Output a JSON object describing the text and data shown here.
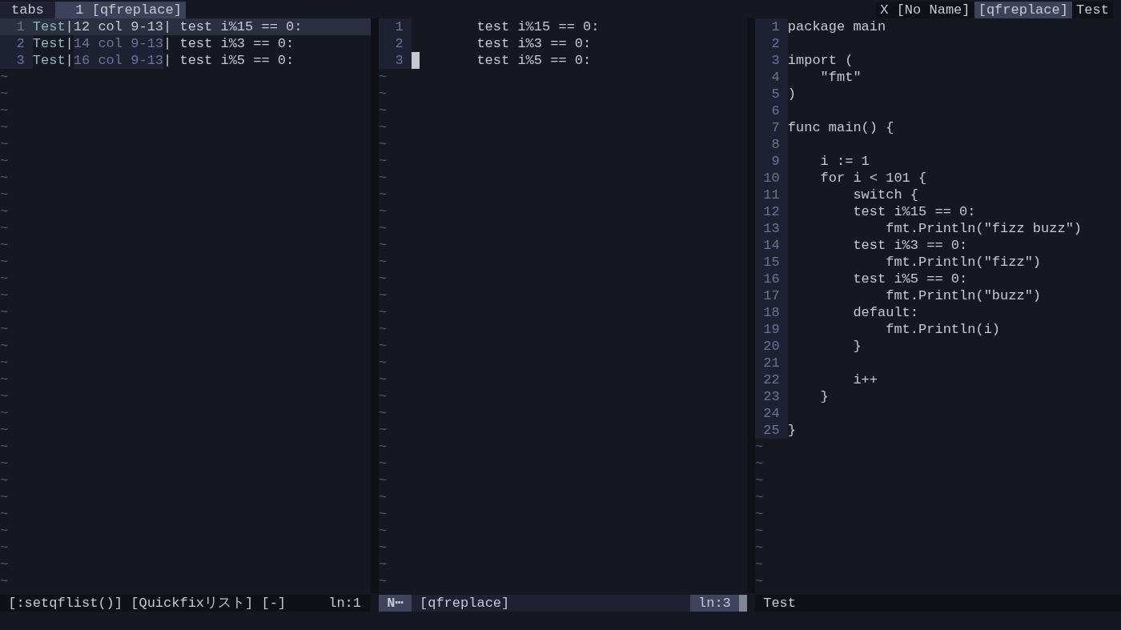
{
  "tabline": {
    "label": "tabs",
    "tabs": [
      {
        "label": "1 [qfreplace]",
        "selected": true
      }
    ],
    "buffers": [
      {
        "label": "X",
        "selected": false
      },
      {
        "label": "[No Name]",
        "selected": false
      },
      {
        "label": "[qfreplace]",
        "selected": true
      },
      {
        "label": "Test",
        "selected": false
      }
    ]
  },
  "panes": [
    {
      "kind": "quickfix",
      "active": false,
      "lines": [
        {
          "number": "1",
          "file": "Test",
          "pipe_1": "|",
          "location": "12 col 9-13",
          "pipe_2": "|",
          "text": " test i%15 == 0:",
          "selected": true
        },
        {
          "number": "2",
          "file": "Test",
          "pipe_1": "|",
          "location": "14 col 9-13",
          "pipe_2": "|",
          "text": " test i%3 == 0:",
          "selected": false
        },
        {
          "number": "3",
          "file": "Test",
          "pipe_1": "|",
          "location": "16 col 9-13",
          "pipe_2": "|",
          "text": " test i%5 == 0:",
          "selected": false
        }
      ],
      "filler": [
        "~",
        "~",
        "~",
        "~",
        "~",
        "~",
        "~",
        "~",
        "~",
        "~",
        "~",
        "~",
        "~",
        "~",
        "~",
        "~",
        "~",
        "~",
        "~",
        "~",
        "~",
        "~",
        "~",
        "~",
        "~",
        "~",
        "~",
        "~",
        "~",
        "~",
        "~"
      ],
      "status": {
        "text": "[:setqflist()] [Quickfixリスト] [-]",
        "position": "ln:1"
      }
    },
    {
      "kind": "editor",
      "active": true,
      "lines": [
        {
          "number": "1",
          "text": "        test i%15 == 0:",
          "cursor": false
        },
        {
          "number": "2",
          "text": "        test i%3 == 0:",
          "cursor": false
        },
        {
          "number": "3",
          "text": "        test i%5 == 0:",
          "cursor": true
        }
      ],
      "filler": [
        "~",
        "~",
        "~",
        "~",
        "~",
        "~",
        "~",
        "~",
        "~",
        "~",
        "~",
        "~",
        "~",
        "~",
        "~",
        "~",
        "~",
        "~",
        "~",
        "~",
        "~",
        "~",
        "~",
        "~",
        "~",
        "~",
        "~",
        "~",
        "~",
        "~",
        "~"
      ],
      "status": {
        "mode": "N⋯",
        "text": "[qfreplace]",
        "position": "ln:3"
      }
    },
    {
      "kind": "editor",
      "active": false,
      "lines": [
        {
          "number": "1",
          "text": "package main",
          "cursor": false
        },
        {
          "number": "2",
          "cursor": false
        },
        {
          "number": "3",
          "text": "import (",
          "cursor": false
        },
        {
          "number": "4",
          "text": "    \"fmt\"",
          "cursor": false
        },
        {
          "number": "5",
          "text": ")",
          "cursor": false
        },
        {
          "number": "6",
          "cursor": false
        },
        {
          "number": "7",
          "text": "func main() {",
          "cursor": false
        },
        {
          "number": "8",
          "cursor": false
        },
        {
          "number": "9",
          "text": "    i := 1",
          "cursor": false
        },
        {
          "number": "10",
          "text": "    for i < 101 {",
          "cursor": false
        },
        {
          "number": "11",
          "text": "        switch {",
          "cursor": false
        },
        {
          "number": "12",
          "text": "        test i%15 == 0:",
          "cursor": false
        },
        {
          "number": "13",
          "text": "            fmt.Println(\"fizz buzz\")",
          "cursor": false
        },
        {
          "number": "14",
          "text": "        test i%3 == 0:",
          "cursor": false
        },
        {
          "number": "15",
          "text": "            fmt.Println(\"fizz\")",
          "cursor": false
        },
        {
          "number": "16",
          "text": "        test i%5 == 0:",
          "cursor": false
        },
        {
          "number": "17",
          "text": "            fmt.Println(\"buzz\")",
          "cursor": false
        },
        {
          "number": "18",
          "text": "        default:",
          "cursor": false
        },
        {
          "number": "19",
          "text": "            fmt.Println(i)",
          "cursor": false
        },
        {
          "number": "20",
          "text": "        }",
          "cursor": false
        },
        {
          "number": "21",
          "cursor": false
        },
        {
          "number": "22",
          "text": "        i++",
          "cursor": false
        },
        {
          "number": "23",
          "text": "    }",
          "cursor": false
        },
        {
          "number": "24",
          "cursor": false
        },
        {
          "number": "25",
          "text": "}",
          "cursor": false
        }
      ],
      "filler": [
        "~",
        "~",
        "~",
        "~",
        "~",
        "~",
        "~",
        "~",
        "~"
      ],
      "status": {
        "text": "Test"
      }
    }
  ]
}
